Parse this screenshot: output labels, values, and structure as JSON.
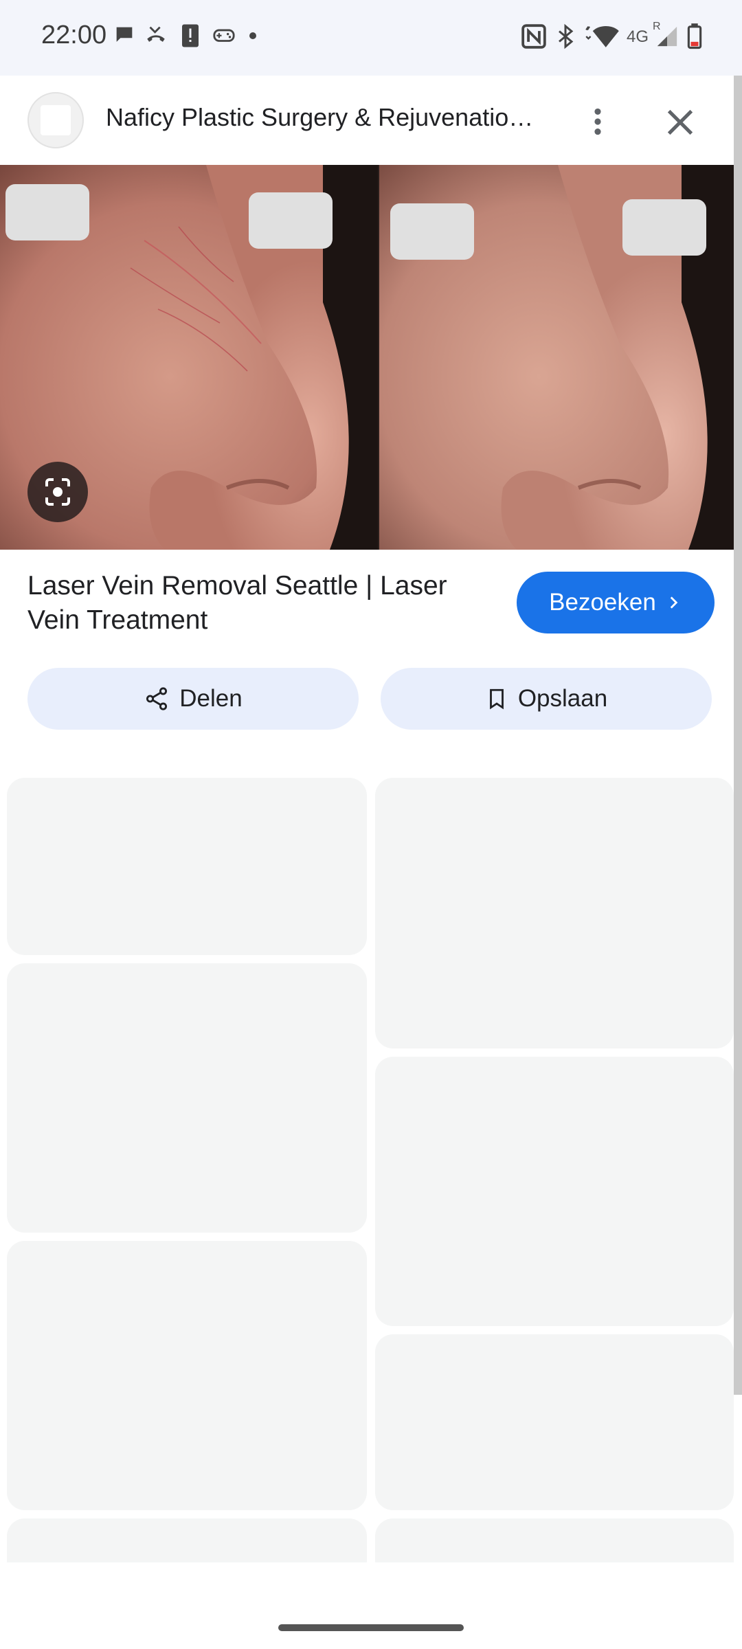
{
  "status_bar": {
    "time": "22:00",
    "network_label": "4G",
    "roaming_label": "R",
    "left_icons": [
      "chat-icon",
      "missed-call-icon",
      "alert-icon",
      "gamepad-icon",
      "dot-icon"
    ],
    "right_icons": [
      "nfc-icon",
      "bluetooth-icon",
      "wifi-icon",
      "signal-icon",
      "battery-icon"
    ]
  },
  "header": {
    "site_title": "Naficy Plastic Surgery & Rejuvenation ...",
    "more_icon": "more-vert-icon",
    "close_icon": "close-icon"
  },
  "hero": {
    "description_icon": "lens-icon"
  },
  "result": {
    "title": "Laser Vein Removal Seattle | Laser Vein Treatment",
    "visit_label": "Bezoeken"
  },
  "actions": {
    "share_label": "Delen",
    "save_label": "Opslaan"
  },
  "colors": {
    "accent": "#1a73e8",
    "action_bg": "#e8eefc",
    "placeholder": "#f4f5f5"
  }
}
